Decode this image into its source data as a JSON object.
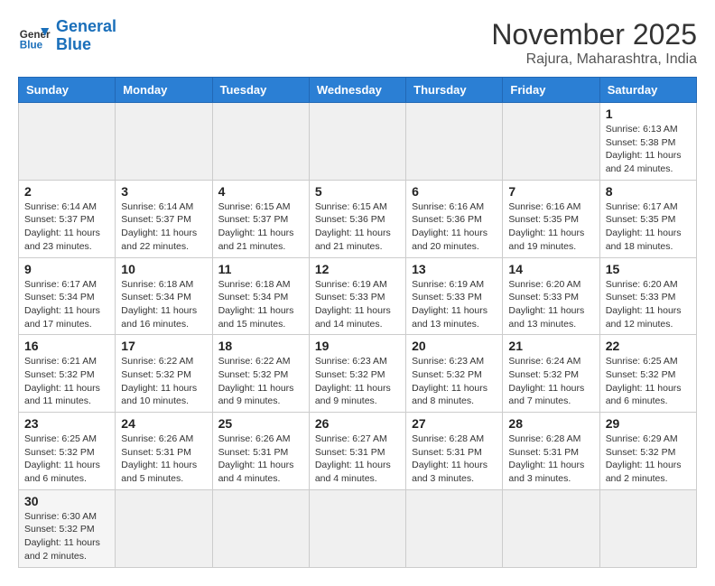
{
  "logo": {
    "general": "General",
    "blue": "Blue"
  },
  "header": {
    "month": "November 2025",
    "location": "Rajura, Maharashtra, India"
  },
  "weekdays": [
    "Sunday",
    "Monday",
    "Tuesday",
    "Wednesday",
    "Thursday",
    "Friday",
    "Saturday"
  ],
  "days": [
    {
      "num": "",
      "info": ""
    },
    {
      "num": "",
      "info": ""
    },
    {
      "num": "",
      "info": ""
    },
    {
      "num": "",
      "info": ""
    },
    {
      "num": "",
      "info": ""
    },
    {
      "num": "",
      "info": ""
    },
    {
      "num": "1",
      "info": "Sunrise: 6:13 AM\nSunset: 5:38 PM\nDaylight: 11 hours\nand 24 minutes."
    },
    {
      "num": "2",
      "info": "Sunrise: 6:14 AM\nSunset: 5:37 PM\nDaylight: 11 hours\nand 23 minutes."
    },
    {
      "num": "3",
      "info": "Sunrise: 6:14 AM\nSunset: 5:37 PM\nDaylight: 11 hours\nand 22 minutes."
    },
    {
      "num": "4",
      "info": "Sunrise: 6:15 AM\nSunset: 5:37 PM\nDaylight: 11 hours\nand 21 minutes."
    },
    {
      "num": "5",
      "info": "Sunrise: 6:15 AM\nSunset: 5:36 PM\nDaylight: 11 hours\nand 21 minutes."
    },
    {
      "num": "6",
      "info": "Sunrise: 6:16 AM\nSunset: 5:36 PM\nDaylight: 11 hours\nand 20 minutes."
    },
    {
      "num": "7",
      "info": "Sunrise: 6:16 AM\nSunset: 5:35 PM\nDaylight: 11 hours\nand 19 minutes."
    },
    {
      "num": "8",
      "info": "Sunrise: 6:17 AM\nSunset: 5:35 PM\nDaylight: 11 hours\nand 18 minutes."
    },
    {
      "num": "9",
      "info": "Sunrise: 6:17 AM\nSunset: 5:34 PM\nDaylight: 11 hours\nand 17 minutes."
    },
    {
      "num": "10",
      "info": "Sunrise: 6:18 AM\nSunset: 5:34 PM\nDaylight: 11 hours\nand 16 minutes."
    },
    {
      "num": "11",
      "info": "Sunrise: 6:18 AM\nSunset: 5:34 PM\nDaylight: 11 hours\nand 15 minutes."
    },
    {
      "num": "12",
      "info": "Sunrise: 6:19 AM\nSunset: 5:33 PM\nDaylight: 11 hours\nand 14 minutes."
    },
    {
      "num": "13",
      "info": "Sunrise: 6:19 AM\nSunset: 5:33 PM\nDaylight: 11 hours\nand 13 minutes."
    },
    {
      "num": "14",
      "info": "Sunrise: 6:20 AM\nSunset: 5:33 PM\nDaylight: 11 hours\nand 13 minutes."
    },
    {
      "num": "15",
      "info": "Sunrise: 6:20 AM\nSunset: 5:33 PM\nDaylight: 11 hours\nand 12 minutes."
    },
    {
      "num": "16",
      "info": "Sunrise: 6:21 AM\nSunset: 5:32 PM\nDaylight: 11 hours\nand 11 minutes."
    },
    {
      "num": "17",
      "info": "Sunrise: 6:22 AM\nSunset: 5:32 PM\nDaylight: 11 hours\nand 10 minutes."
    },
    {
      "num": "18",
      "info": "Sunrise: 6:22 AM\nSunset: 5:32 PM\nDaylight: 11 hours\nand 9 minutes."
    },
    {
      "num": "19",
      "info": "Sunrise: 6:23 AM\nSunset: 5:32 PM\nDaylight: 11 hours\nand 9 minutes."
    },
    {
      "num": "20",
      "info": "Sunrise: 6:23 AM\nSunset: 5:32 PM\nDaylight: 11 hours\nand 8 minutes."
    },
    {
      "num": "21",
      "info": "Sunrise: 6:24 AM\nSunset: 5:32 PM\nDaylight: 11 hours\nand 7 minutes."
    },
    {
      "num": "22",
      "info": "Sunrise: 6:25 AM\nSunset: 5:32 PM\nDaylight: 11 hours\nand 6 minutes."
    },
    {
      "num": "23",
      "info": "Sunrise: 6:25 AM\nSunset: 5:32 PM\nDaylight: 11 hours\nand 6 minutes."
    },
    {
      "num": "24",
      "info": "Sunrise: 6:26 AM\nSunset: 5:31 PM\nDaylight: 11 hours\nand 5 minutes."
    },
    {
      "num": "25",
      "info": "Sunrise: 6:26 AM\nSunset: 5:31 PM\nDaylight: 11 hours\nand 4 minutes."
    },
    {
      "num": "26",
      "info": "Sunrise: 6:27 AM\nSunset: 5:31 PM\nDaylight: 11 hours\nand 4 minutes."
    },
    {
      "num": "27",
      "info": "Sunrise: 6:28 AM\nSunset: 5:31 PM\nDaylight: 11 hours\nand 3 minutes."
    },
    {
      "num": "28",
      "info": "Sunrise: 6:28 AM\nSunset: 5:31 PM\nDaylight: 11 hours\nand 3 minutes."
    },
    {
      "num": "29",
      "info": "Sunrise: 6:29 AM\nSunset: 5:32 PM\nDaylight: 11 hours\nand 2 minutes."
    },
    {
      "num": "30",
      "info": "Sunrise: 6:30 AM\nSunset: 5:32 PM\nDaylight: 11 hours\nand 2 minutes."
    },
    {
      "num": "",
      "info": ""
    },
    {
      "num": "",
      "info": ""
    },
    {
      "num": "",
      "info": ""
    },
    {
      "num": "",
      "info": ""
    },
    {
      "num": "",
      "info": ""
    },
    {
      "num": "",
      "info": ""
    }
  ]
}
